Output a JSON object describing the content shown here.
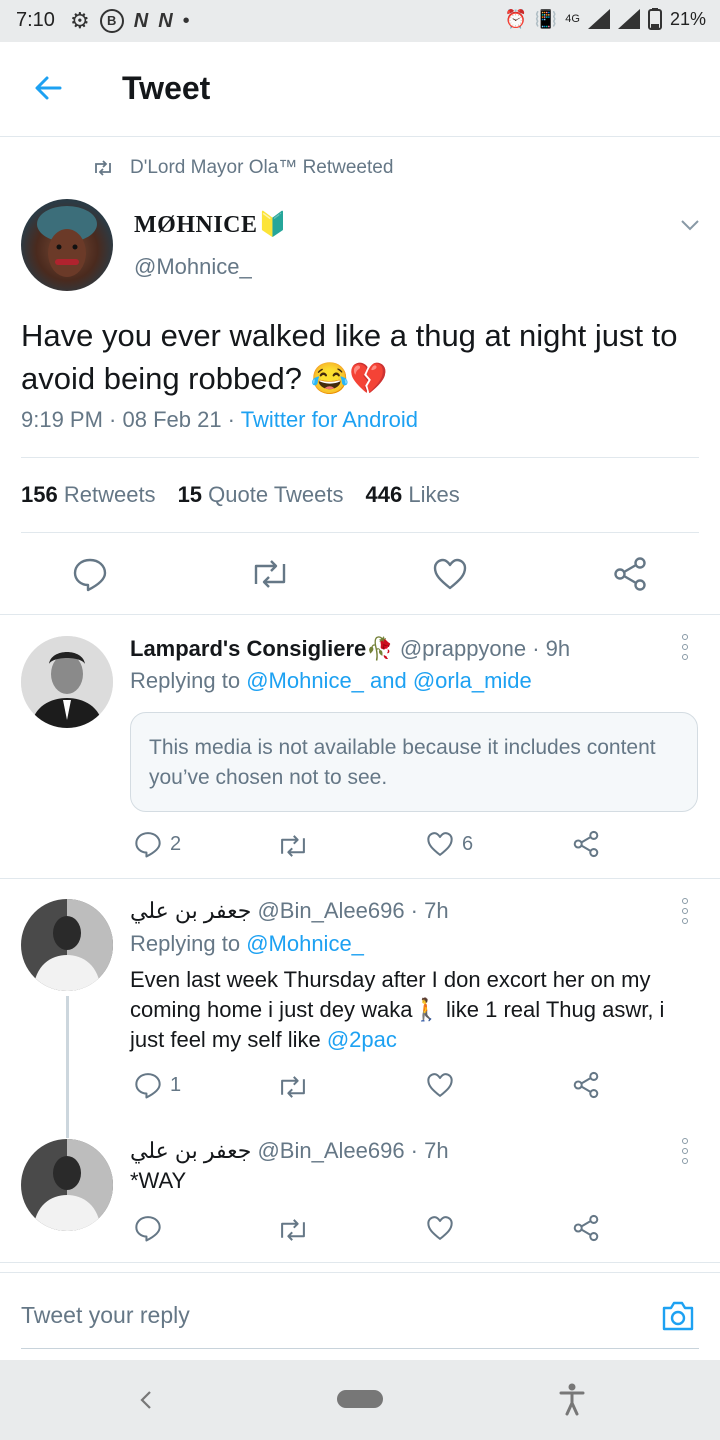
{
  "status_bar": {
    "time": "7:10",
    "battery": "21%",
    "network": "4G"
  },
  "header": {
    "title": "Tweet"
  },
  "main_tweet": {
    "retweeted_by": "D'Lord Mayor Ola™ Retweeted",
    "display_name": "MØHNICE",
    "display_name_badge": "🔰",
    "handle": "@Mohnice_",
    "text": "Have you ever walked like a thug at night just to avoid being robbed? 😂💔",
    "time": "9:19 PM · 08 Feb 21 · ",
    "source": "Twitter for Android",
    "stats": {
      "retweets_count": "156",
      "retweets_label": "Retweets",
      "quotes_count": "15",
      "quotes_label": "Quote Tweets",
      "likes_count": "446",
      "likes_label": "Likes"
    }
  },
  "replies": [
    {
      "display_name": "Lampard's Consigliere🥀",
      "meta": "@prappyone · 9h",
      "replying_prefix": "Replying to ",
      "replying_to": "@Mohnice_ and @orla_mide",
      "notice": "This media is not available because it includes content you’ve chosen not to see.",
      "reply_count": "2",
      "like_count": "6"
    },
    {
      "display_name": "جعفر بن علي",
      "meta": "@Bin_Alee696 · 7h",
      "replying_prefix": "Replying to ",
      "replying_to": "@Mohnice_",
      "text_1": "Even last week Thursday after I don excort her on my coming home i just dey waka🚶 like 1 real Thug aswr, i just feel my self like ",
      "mention": "@2pac",
      "reply_count": "1"
    },
    {
      "display_name": "جعفر بن علي",
      "meta": "@Bin_Alee696 · 7h",
      "text": "*WAY"
    }
  ],
  "composer": {
    "placeholder": "Tweet your reply"
  },
  "colors": {
    "accent": "#1da1f2",
    "muted": "#657786",
    "divider": "#e1e8ed"
  }
}
